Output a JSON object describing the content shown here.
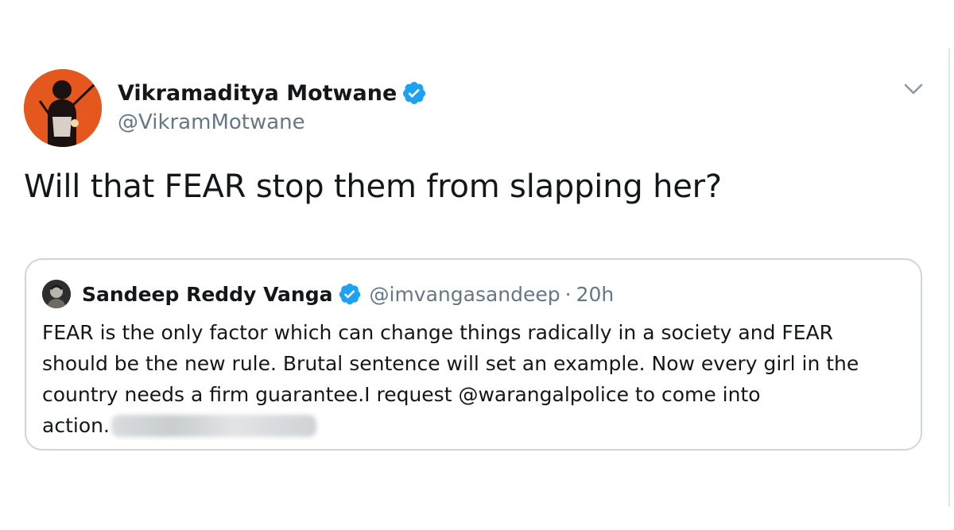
{
  "tweet": {
    "author": {
      "display_name": "Vikramaditya Motwane",
      "handle": "@VikramMotwane",
      "verified": true
    },
    "text": "Will that FEAR stop them from slapping her?",
    "menu_icon": "chevron-down-icon"
  },
  "quoted_tweet": {
    "author": {
      "display_name": "Sandeep Reddy Vanga",
      "handle": "@imvangasandeep",
      "verified": true
    },
    "separator": "·",
    "time": "20h",
    "lines": [
      "FEAR is the only factor which can change things radically in a society and FEAR",
      "should be the new rule. Brutal sentence will set an example. Now every girl in the",
      "country needs a firm guarantee.I request @warangalpolice to come into",
      "action."
    ]
  },
  "colors": {
    "verified_blue": "#1da1f2",
    "secondary_text": "#657786",
    "primary_text": "#14171a",
    "border": "#ccd6dd",
    "avatar_bg": "#e4571d"
  }
}
